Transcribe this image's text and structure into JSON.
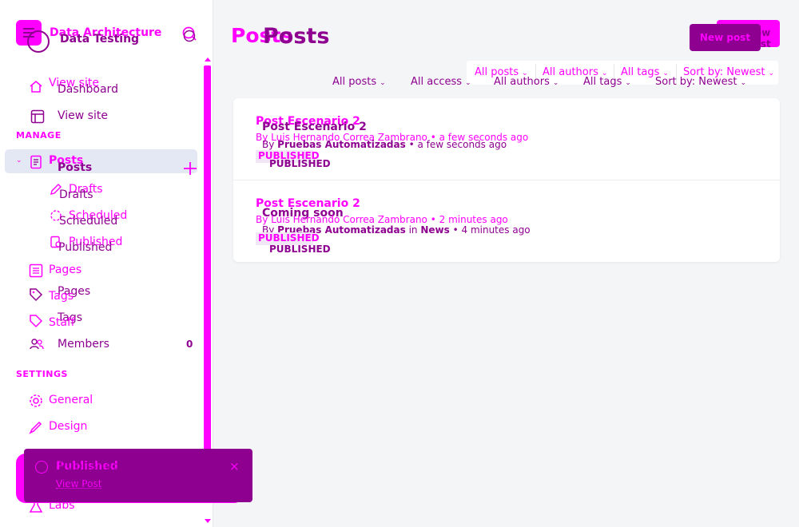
{
  "site": {
    "title": "Data Architecture",
    "title_overlay": "Data Testing"
  },
  "nav": {
    "view_site_a": "View site",
    "dashboard": "Dashboard",
    "view_site": "View site",
    "manage_label": "MANAGE",
    "posts_a": "Posts",
    "posts": "Posts",
    "drafts_a": "Drafts",
    "drafts": "Drafts",
    "scheduled_a": "Scheduled",
    "scheduled": "Scheduled",
    "published_a": "Published",
    "published": "Published",
    "pages_a": "Pages",
    "pages": "Pages",
    "tags_a": "Tags",
    "tags": "Tags",
    "staff_a": "Staff",
    "members": "Members",
    "members_count": "0",
    "settings_label": "SETTINGS",
    "general": "General",
    "design": "Design",
    "labs": "Labs"
  },
  "toast": {
    "title": "Published",
    "title_overlay": "Published",
    "link": "View Post",
    "link_overlay": "View Post",
    "close": "×"
  },
  "header": {
    "title_a": "Posts",
    "title_b": "Posts",
    "new_post_a": "New post",
    "new_post_b": "New post"
  },
  "filters_top": {
    "all_posts": "All posts",
    "all_authors": "All authors",
    "all_tags": "All tags",
    "sort": "Sort by: Newest"
  },
  "filters_bottom": {
    "all_posts": "All posts",
    "all_access": "All access",
    "all_authors": "All authors",
    "all_tags": "All tags",
    "sort": "Sort by: Newest"
  },
  "posts": [
    {
      "title_a": "Post Escenario 2",
      "title_b": "Post Escenario 2",
      "meta_a_by": "By",
      "meta_a_author": "Luis Hernando Correa Zambrano",
      "meta_a_time": "• a few seconds ago",
      "meta_b_by": "By",
      "meta_b_author": "Pruebas Automatizadas",
      "meta_b_time": "• a few seconds ago",
      "status_a": "PUBLISHED",
      "status_b": "PUBLISHED"
    },
    {
      "title_a": "Post Escenario 2",
      "title_b": "Coming soon",
      "meta_a_by": "By",
      "meta_a_author": "Luis Hernando Correa Zambrano",
      "meta_a_time": "• 2 minutes ago",
      "meta_b_by": "By",
      "meta_b_author": "Pruebas Automatizadas",
      "meta_b_in": "in",
      "meta_b_tag": "News",
      "meta_b_time": "• 4 minutes ago",
      "status_a": "PUBLISHED",
      "status_b": "PUBLISHED"
    }
  ],
  "colors": {
    "accent": "#ff00ff",
    "accent_dark": "#8e0190",
    "active_row": "#e4e7f4",
    "background": "#f4f5f7"
  }
}
